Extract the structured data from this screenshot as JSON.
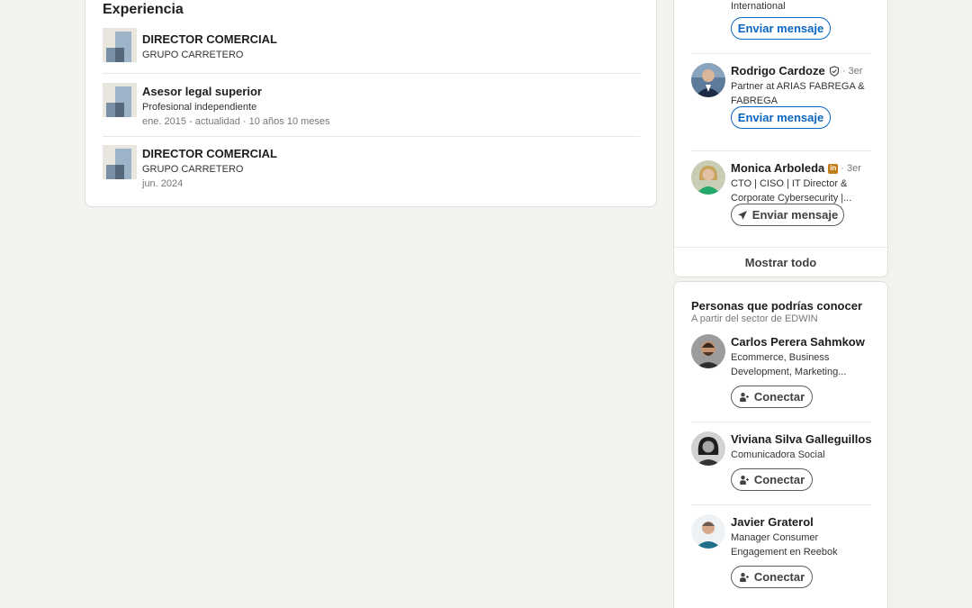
{
  "experience": {
    "title": "Experiencia",
    "items": [
      {
        "role": "DIRECTOR COMERCIAL",
        "company": "GRUPO CARRETERO",
        "dates": ""
      },
      {
        "role": "Asesor legal superior",
        "company": "Profesional independiente",
        "dates": "ene. 2015 - actualidad · 10 años 10 meses"
      },
      {
        "role": "DIRECTOR COMERCIAL",
        "company": "GRUPO CARRETERO",
        "dates": "jun. 2024"
      }
    ]
  },
  "messaging": {
    "partial_desc": "International",
    "button_label": "Enviar mensaje",
    "people": [
      {
        "name": "Rodrigo Cardoze",
        "degree": "· 3er",
        "desc": "Partner at ARIAS FABREGA & FABREGA"
      },
      {
        "name": "Monica Arboleda",
        "degree": "· 3er",
        "desc": "CTO | CISO | IT Director & Corporate Cybersecurity |..."
      }
    ],
    "show_all": "Mostrar todo"
  },
  "pymk": {
    "title": "Personas que podrías conocer",
    "subtitle": "A partir del sector de EDWIN",
    "button_label": "Conectar",
    "people": [
      {
        "name": "Carlos Perera Sahmkow",
        "desc": "Ecommerce, Business Development, Marketing..."
      },
      {
        "name": "Viviana Silva Galleguillos",
        "desc": "Comunicadora Social"
      },
      {
        "name": "Javier Graterol",
        "desc": "Manager Consumer Engagement en Reebok"
      }
    ]
  },
  "colors": {
    "accent": "#0a66c2",
    "page_bg": "#f4f2ee",
    "premium": "#c37d16"
  },
  "icons": [
    "company-logo-icon",
    "verified-icon",
    "linkedin-premium-icon",
    "send-icon",
    "add-person-icon"
  ]
}
